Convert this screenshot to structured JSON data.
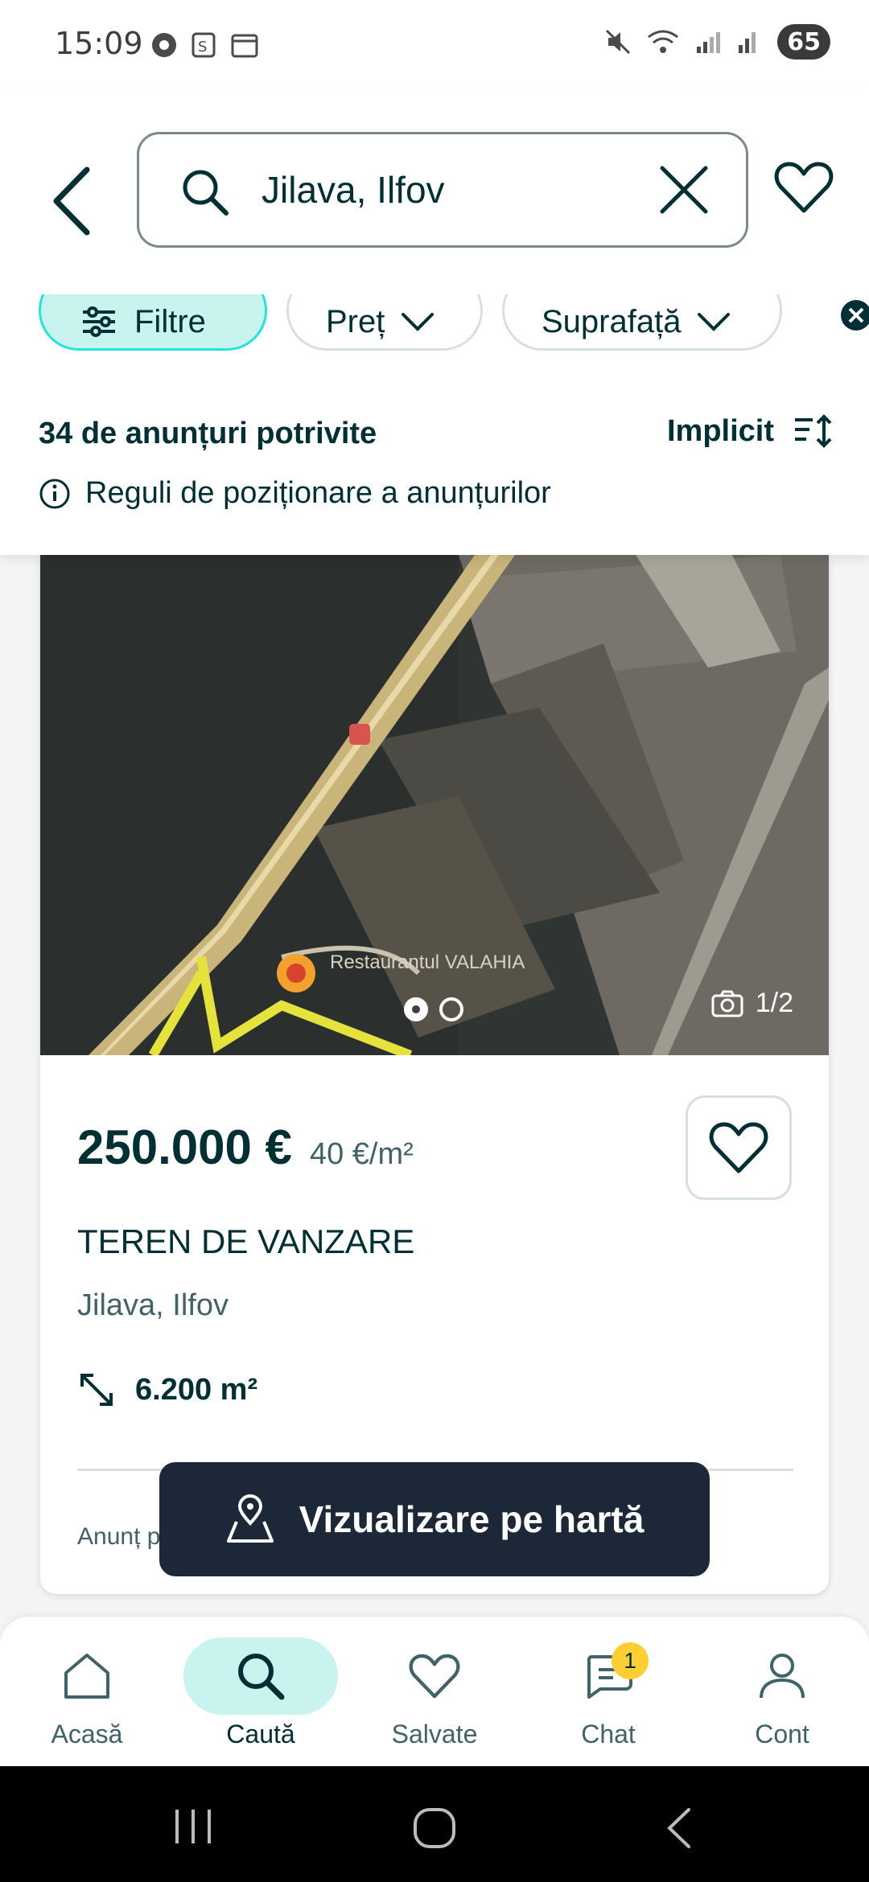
{
  "status_bar": {
    "time": "15:09",
    "battery": "65"
  },
  "search": {
    "query": "Jilava, Ilfov"
  },
  "filters": {
    "filter_label": "Filtre",
    "price_label": "Preț",
    "area_label": "Suprafață"
  },
  "results": {
    "count_text": "34 de anunțuri potrivite",
    "sort_label": "Implicit",
    "rules_text": "Reguli de poziționare a anunțurilor"
  },
  "listing": {
    "image_caption": "Restaurantul VALAHIA",
    "photo_counter": "1/2",
    "price": "250.000 €",
    "price_per_m2": "40 €/m²",
    "title": "TEREN DE VANZARE",
    "location": "Jilava, Ilfov",
    "area": "6.200 m²",
    "footer_note": "Anunț p"
  },
  "map_button": {
    "label": "Vizualizare pe hartă"
  },
  "bottom_nav": {
    "home": "Acasă",
    "search": "Caută",
    "saved": "Salvate",
    "chat": "Chat",
    "chat_badge": "1",
    "account": "Cont"
  },
  "colors": {
    "accent_teal": "#23e5db",
    "active_bg": "#c8f3ee",
    "brand_dark": "#002f34",
    "badge": "#ffce32"
  }
}
